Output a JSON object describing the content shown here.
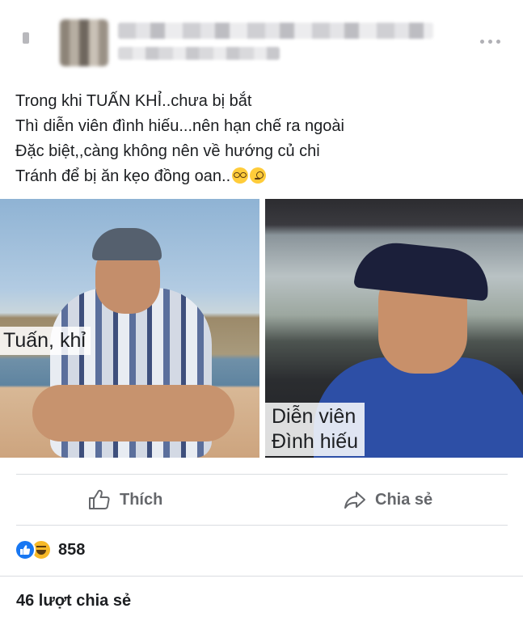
{
  "post": {
    "lines": [
      "Trong khi TUẤN KHỈ..chưa bị bắt",
      "Thì diễn viên đình hiếu...nên hạn chế ra ngoài",
      "Đặc biệt,,càng không nên về hướng củ chi",
      "Tránh để bị ăn kẹo đồng oan.."
    ],
    "trailing_emojis": [
      "nerd-face-icon",
      "monocle-face-icon"
    ]
  },
  "photos": {
    "left_caption": "Tuấn, khỉ",
    "right_caption_line1": "Diễn viên",
    "right_caption_line2": "Đình hiếu"
  },
  "actions": {
    "like_label": "Thích",
    "share_label": "Chia sẻ"
  },
  "reactions": {
    "icons": [
      "like-reaction-icon",
      "haha-reaction-icon"
    ],
    "count": "858"
  },
  "shares": {
    "text": "46 lượt chia sẻ"
  },
  "colors": {
    "facebook_blue": "#1877f2",
    "haha_yellow": "#f7b928",
    "action_gray": "#65676b",
    "separator": "#dadde1"
  }
}
